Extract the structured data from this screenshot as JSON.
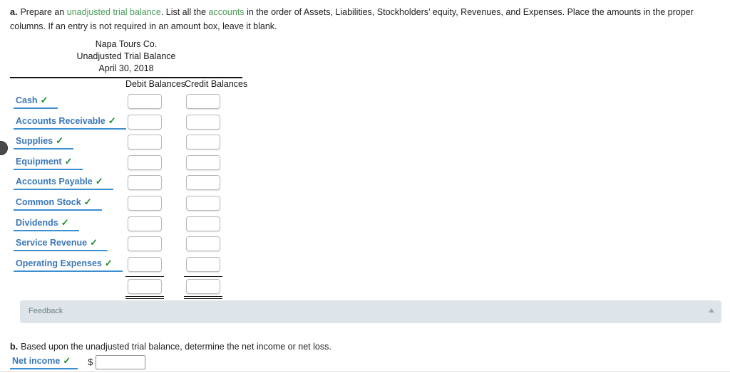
{
  "part_a": {
    "letter": "a.",
    "text_1": "Prepare an ",
    "link_1": "unadjusted trial balance",
    "text_2": ". List all the ",
    "link_2": "accounts",
    "text_3": " in the order of Assets, Liabilities, Stockholders’ equity, Revenues, and Expenses. Place the amounts in the proper columns. If an entry is not required in an amount box, leave it blank."
  },
  "statement": {
    "company": "Napa Tours Co.",
    "title": "Unadjusted Trial Balance",
    "date": "April 30, 2018",
    "columns": {
      "debit": "Debit Balances",
      "credit": "Credit Balances"
    },
    "check_glyph": "✓",
    "rows": [
      {
        "account": "Cash",
        "debit": "",
        "credit": "",
        "checked": true
      },
      {
        "account": "Accounts Receivable",
        "debit": "",
        "credit": "",
        "checked": true
      },
      {
        "account": "Supplies",
        "debit": "",
        "credit": "",
        "checked": true
      },
      {
        "account": "Equipment",
        "debit": "",
        "credit": "",
        "checked": true
      },
      {
        "account": "Accounts Payable",
        "debit": "",
        "credit": "",
        "checked": true
      },
      {
        "account": "Common Stock",
        "debit": "",
        "credit": "",
        "checked": true
      },
      {
        "account": "Dividends",
        "debit": "",
        "credit": "",
        "checked": true
      },
      {
        "account": "Service Revenue",
        "debit": "",
        "credit": "",
        "checked": true
      },
      {
        "account": "Operating Expenses",
        "debit": "",
        "credit": "",
        "checked": true
      }
    ],
    "totals": {
      "debit": "",
      "credit": ""
    }
  },
  "feedback": {
    "label": "Feedback",
    "toggle_icon": "collapse-triangle-icon"
  },
  "part_b": {
    "letter": "b.",
    "text": "Based upon the unadjusted trial balance, determine the net income or net loss.",
    "result_label": "Net income",
    "check_glyph": "✓",
    "currency_symbol": "$",
    "amount": ""
  },
  "colors": {
    "account_link": "#3b77b8",
    "link_underline": "#3b8ed0",
    "glossary_link": "#4a9c58",
    "check_green": "#17902a",
    "feedback_bg": "#dde5ea"
  }
}
